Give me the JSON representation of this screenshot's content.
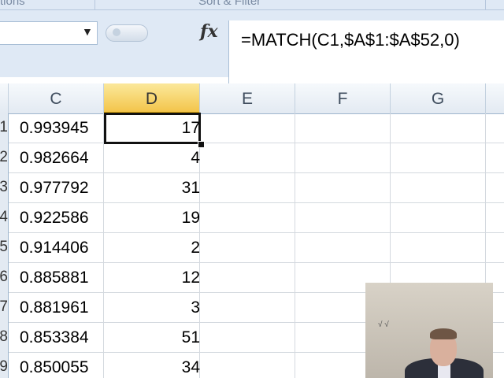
{
  "ribbon": {
    "group_left": "tions",
    "group_right": "Sort & Filter"
  },
  "formula_bar": {
    "fx_label": "fx",
    "formula": "=MATCH(C1,$A$1:$A$52,0)"
  },
  "columns": [
    "C",
    "D",
    "E",
    "F",
    "G"
  ],
  "active_column": "D",
  "row_numbers": [
    "1",
    "2",
    "3",
    "4",
    "5",
    "6",
    "7",
    "8",
    "9"
  ],
  "rows": [
    {
      "c": "0.993945",
      "d": "17"
    },
    {
      "c": "0.982664",
      "d": "4"
    },
    {
      "c": "0.977792",
      "d": "31"
    },
    {
      "c": "0.922586",
      "d": "19"
    },
    {
      "c": "0.914406",
      "d": "2"
    },
    {
      "c": "0.885881",
      "d": "12"
    },
    {
      "c": "0.881961",
      "d": "3"
    },
    {
      "c": "0.853384",
      "d": "51"
    },
    {
      "c": "0.850055",
      "d": "34"
    }
  ],
  "webcam": {
    "mark": "√ √"
  }
}
